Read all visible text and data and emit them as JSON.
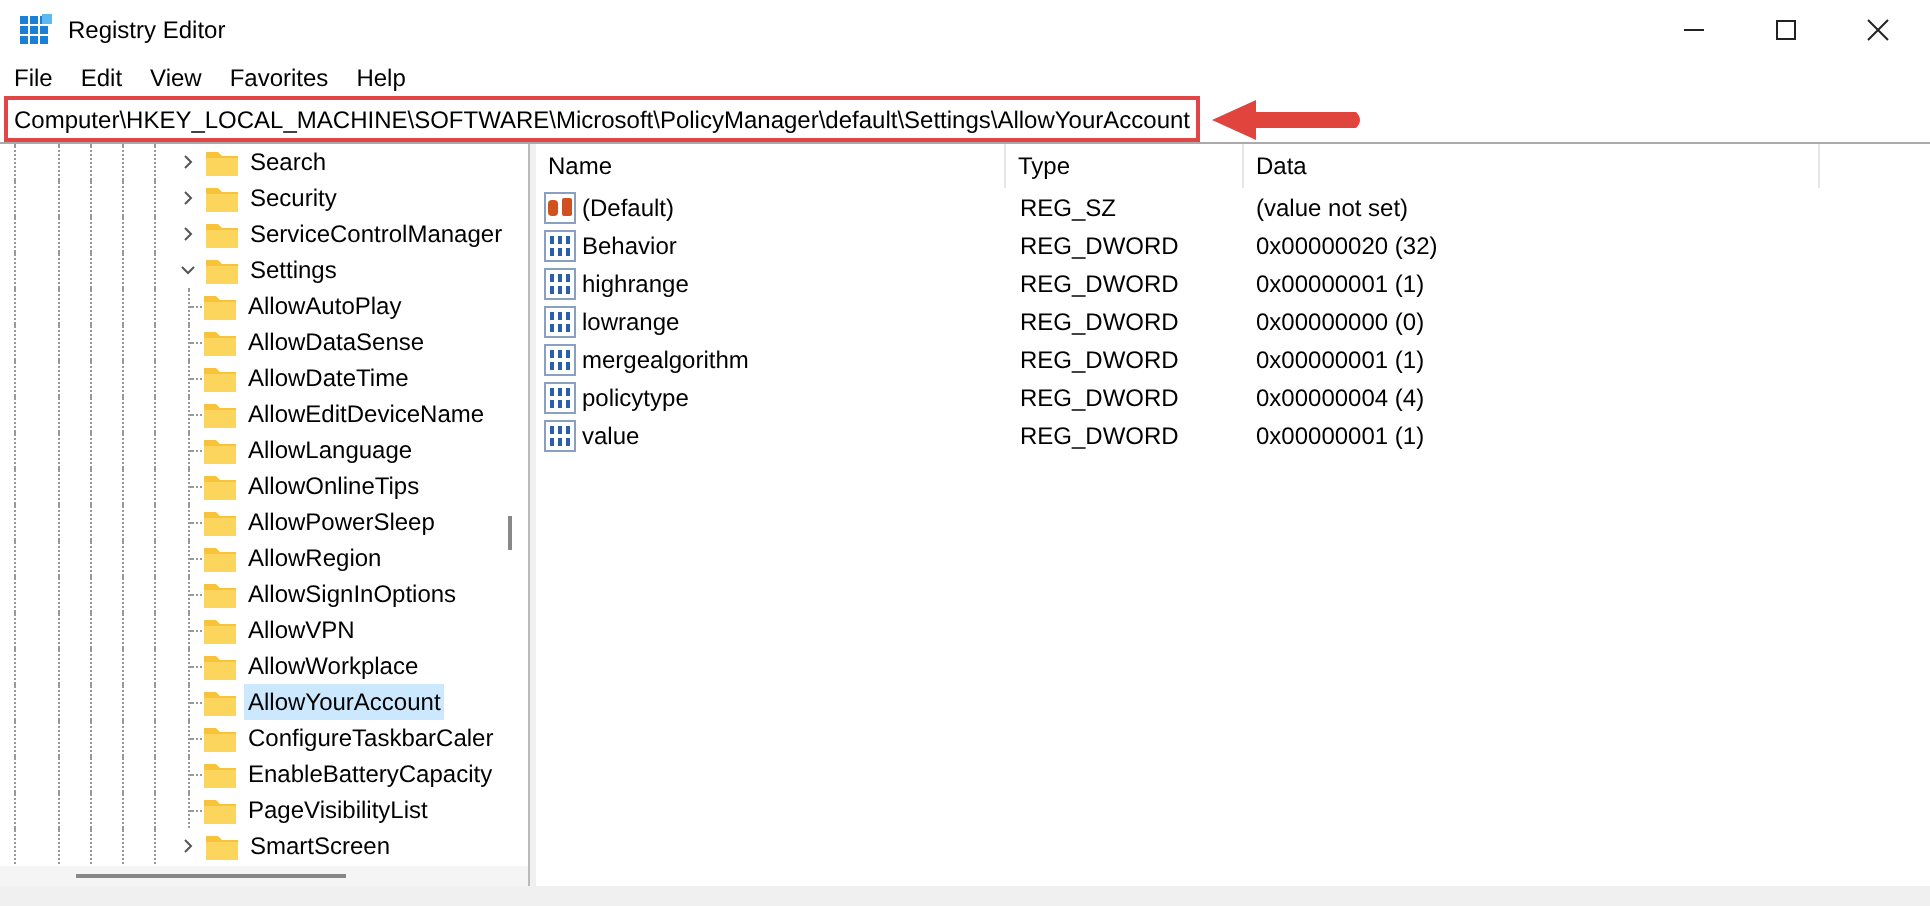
{
  "window": {
    "title": "Registry Editor"
  },
  "menu": [
    "File",
    "Edit",
    "View",
    "Favorites",
    "Help"
  ],
  "address": {
    "value": "Computer\\HKEY_LOCAL_MACHINE\\SOFTWARE\\Microsoft\\PolicyManager\\default\\Settings\\AllowYourAccount"
  },
  "tree": [
    {
      "label": "Search",
      "expanded": false,
      "selected": false
    },
    {
      "label": "Security",
      "expanded": false,
      "selected": false
    },
    {
      "label": "ServiceControlManager",
      "expanded": false,
      "selected": false
    },
    {
      "label": "Settings",
      "expanded": true,
      "selected": false,
      "children": [
        {
          "label": "AllowAutoPlay",
          "selected": false
        },
        {
          "label": "AllowDataSense",
          "selected": false
        },
        {
          "label": "AllowDateTime",
          "selected": false
        },
        {
          "label": "AllowEditDeviceName",
          "selected": false
        },
        {
          "label": "AllowLanguage",
          "selected": false
        },
        {
          "label": "AllowOnlineTips",
          "selected": false
        },
        {
          "label": "AllowPowerSleep",
          "selected": false
        },
        {
          "label": "AllowRegion",
          "selected": false
        },
        {
          "label": "AllowSignInOptions",
          "selected": false
        },
        {
          "label": "AllowVPN",
          "selected": false
        },
        {
          "label": "AllowWorkplace",
          "selected": false
        },
        {
          "label": "AllowYourAccount",
          "selected": true
        },
        {
          "label": "ConfigureTaskbarCaler",
          "selected": false
        },
        {
          "label": "EnableBatteryCapacity",
          "selected": false
        },
        {
          "label": "PageVisibilityList",
          "selected": false
        }
      ]
    },
    {
      "label": "SmartScreen",
      "expanded": false,
      "selected": false
    }
  ],
  "table": {
    "columns": [
      "Name",
      "Type",
      "Data"
    ],
    "rows": [
      {
        "kind": "string",
        "name": "(Default)",
        "type": "REG_SZ",
        "data": "(value not set)"
      },
      {
        "kind": "binary",
        "name": "Behavior",
        "type": "REG_DWORD",
        "data": "0x00000020 (32)"
      },
      {
        "kind": "binary",
        "name": "highrange",
        "type": "REG_DWORD",
        "data": "0x00000001 (1)"
      },
      {
        "kind": "binary",
        "name": "lowrange",
        "type": "REG_DWORD",
        "data": "0x00000000 (0)"
      },
      {
        "kind": "binary",
        "name": "mergealgorithm",
        "type": "REG_DWORD",
        "data": "0x00000001 (1)"
      },
      {
        "kind": "binary",
        "name": "policytype",
        "type": "REG_DWORD",
        "data": "0x00000004 (4)"
      },
      {
        "kind": "binary",
        "name": "value",
        "type": "REG_DWORD",
        "data": "0x00000001 (1)"
      }
    ]
  }
}
